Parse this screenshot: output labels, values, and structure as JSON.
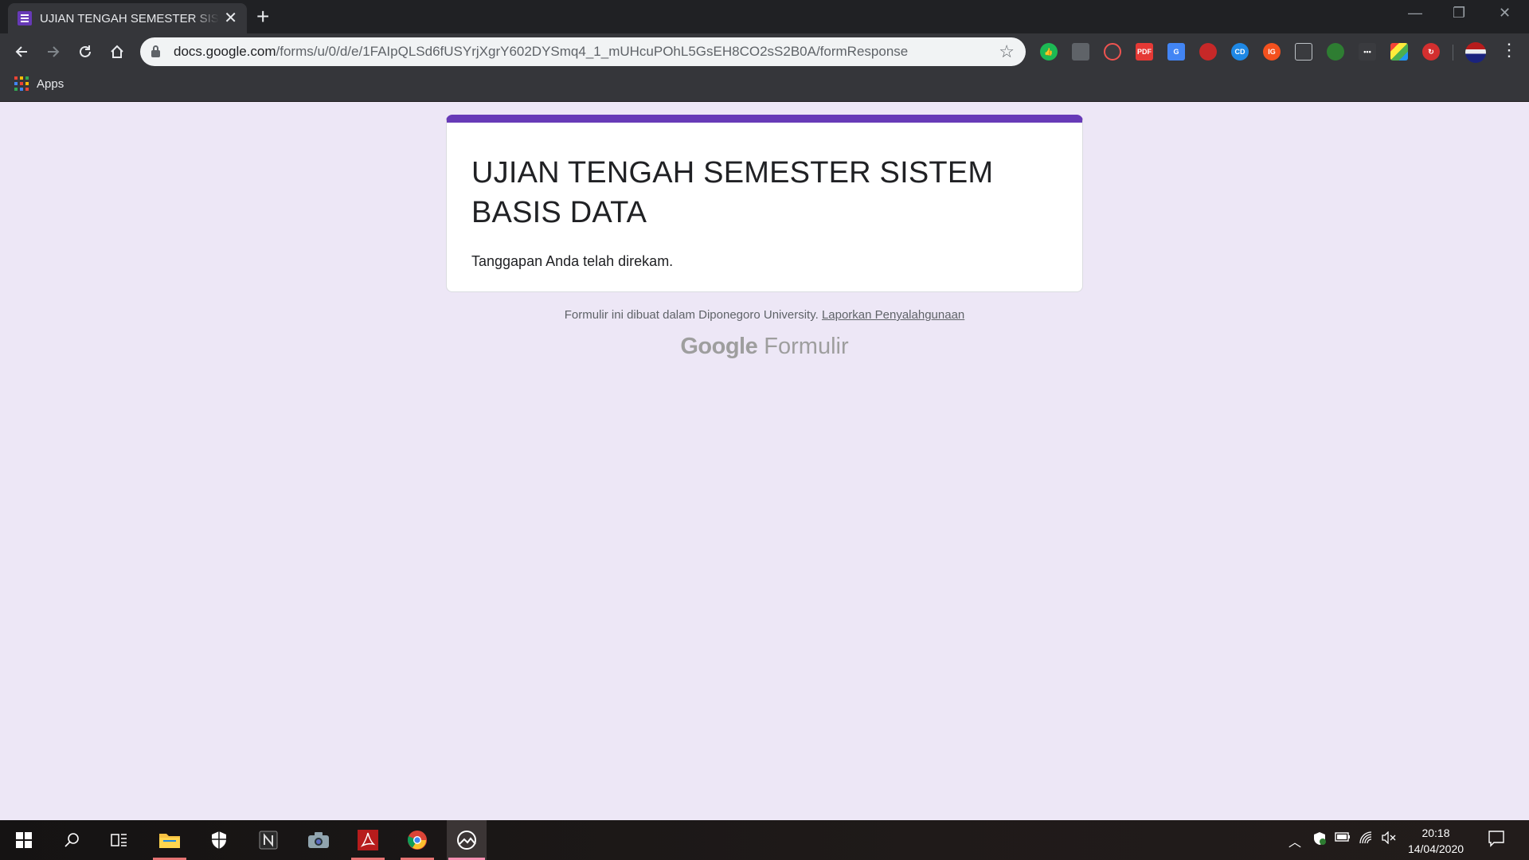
{
  "browser": {
    "tab_title": "UJIAN TENGAH SEMESTER SISTEM BASIS DATA",
    "url_domain": "docs.google.com",
    "url_path": "/forms/u/0/d/e/1FAIpQLSd6fUSYrjXgrY602DYSmq4_1_mUHcuPOhL5GsEH8CO2sS2B0A/formResponse",
    "bookmarks": {
      "apps_label": "Apps"
    },
    "extensions": [
      "green-thumb-icon",
      "cube-icon",
      "link-icon",
      "pdf-icon",
      "translate-icon",
      "red-circle-icon",
      "cd-icon",
      "ig-icon",
      "reader-icon",
      "globe-icon",
      "more-icon",
      "color-grid-icon",
      "refresh-red-icon"
    ]
  },
  "form": {
    "title": "UJIAN TENGAH SEMESTER SISTEM BASIS DATA",
    "confirmation": "Tanggapan Anda telah direkam.",
    "footer_text": "Formulir ini dibuat dalam Diponegoro University.",
    "report_link": "Laporkan Penyalahgunaan",
    "logo_google": "Google",
    "logo_product": "Formulir",
    "accent_color": "#673ab7",
    "background_color": "#ede7f6"
  },
  "taskbar": {
    "clock_time": "20:18",
    "clock_date": "14/04/2020"
  }
}
